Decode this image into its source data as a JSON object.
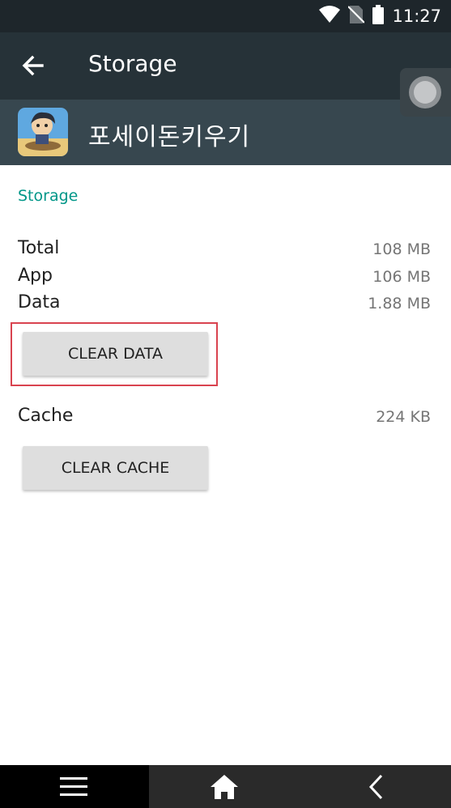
{
  "status_bar": {
    "time": "11:27",
    "icons": [
      "wifi-icon",
      "no-sim-icon",
      "battery-icon"
    ]
  },
  "app_bar": {
    "title": "Storage",
    "back_icon": "arrow-back-icon"
  },
  "app_header": {
    "app_name": "포세이돈키우기",
    "app_icon": "game-app-icon"
  },
  "storage": {
    "section_title": "Storage",
    "rows": [
      {
        "label": "Total",
        "value": "108 MB"
      },
      {
        "label": "App",
        "value": "106 MB"
      },
      {
        "label": "Data",
        "value": "1.88 MB"
      }
    ],
    "clear_data_label": "CLEAR DATA"
  },
  "cache": {
    "label": "Cache",
    "value": "224 KB",
    "clear_cache_label": "CLEAR CACHE"
  },
  "nav_bar": {
    "icons": [
      "menu-icon",
      "home-icon",
      "back-icon"
    ]
  },
  "colors": {
    "status_bar": "#1e262b",
    "app_bar": "#263238",
    "app_header": "#37474f",
    "accent": "#009688",
    "highlight": "#d9434f"
  }
}
